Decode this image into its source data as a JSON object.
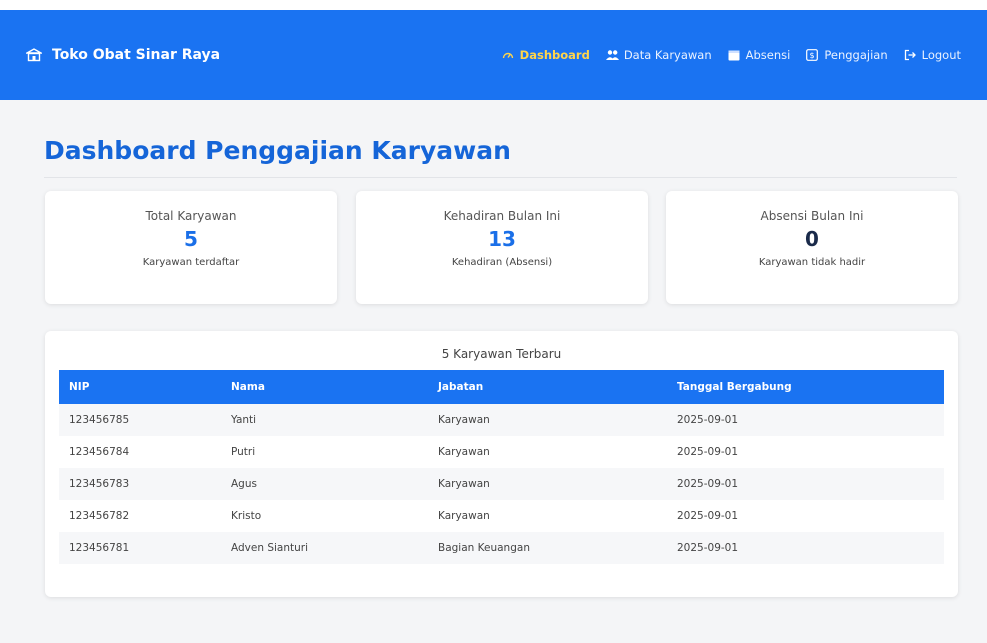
{
  "navbar": {
    "brand": "Toko Obat Sinar Raya",
    "links": [
      {
        "label": "Dashboard",
        "icon": "dashboard-icon",
        "active": true
      },
      {
        "label": "Data Karyawan",
        "icon": "users-icon",
        "active": false
      },
      {
        "label": "Absensi",
        "icon": "calendar-icon",
        "active": false
      },
      {
        "label": "Penggajian",
        "icon": "payroll-icon",
        "active": false
      },
      {
        "label": "Logout",
        "icon": "logout-icon",
        "active": false
      }
    ]
  },
  "page": {
    "title": "Dashboard Penggajian Karyawan"
  },
  "stats": [
    {
      "title": "Total Karyawan",
      "value": "5",
      "subtitle": "Karyawan terdaftar"
    },
    {
      "title": "Kehadiran Bulan Ini",
      "value": "13",
      "subtitle": "Kehadiran (Absensi)"
    },
    {
      "title": "Absensi Bulan Ini",
      "value": "0",
      "subtitle": "Karyawan tidak hadir"
    }
  ],
  "table": {
    "caption": "5 Karyawan Terbaru",
    "columns": [
      "NIP",
      "Nama",
      "Jabatan",
      "Tanggal Bergabung"
    ],
    "rows": [
      [
        "123456785",
        "Yanti",
        "Karyawan",
        "2025-09-01"
      ],
      [
        "123456784",
        "Putri",
        "Karyawan",
        "2025-09-01"
      ],
      [
        "123456783",
        "Agus",
        "Karyawan",
        "2025-09-01"
      ],
      [
        "123456782",
        "Kristo",
        "Karyawan",
        "2025-09-01"
      ],
      [
        "123456781",
        "Adven Sianturi",
        "Bagian Keuangan",
        "2025-09-01"
      ]
    ]
  },
  "colors": {
    "primary": "#1a73f2",
    "title": "#1565d8",
    "active_link": "#ffd54a"
  }
}
